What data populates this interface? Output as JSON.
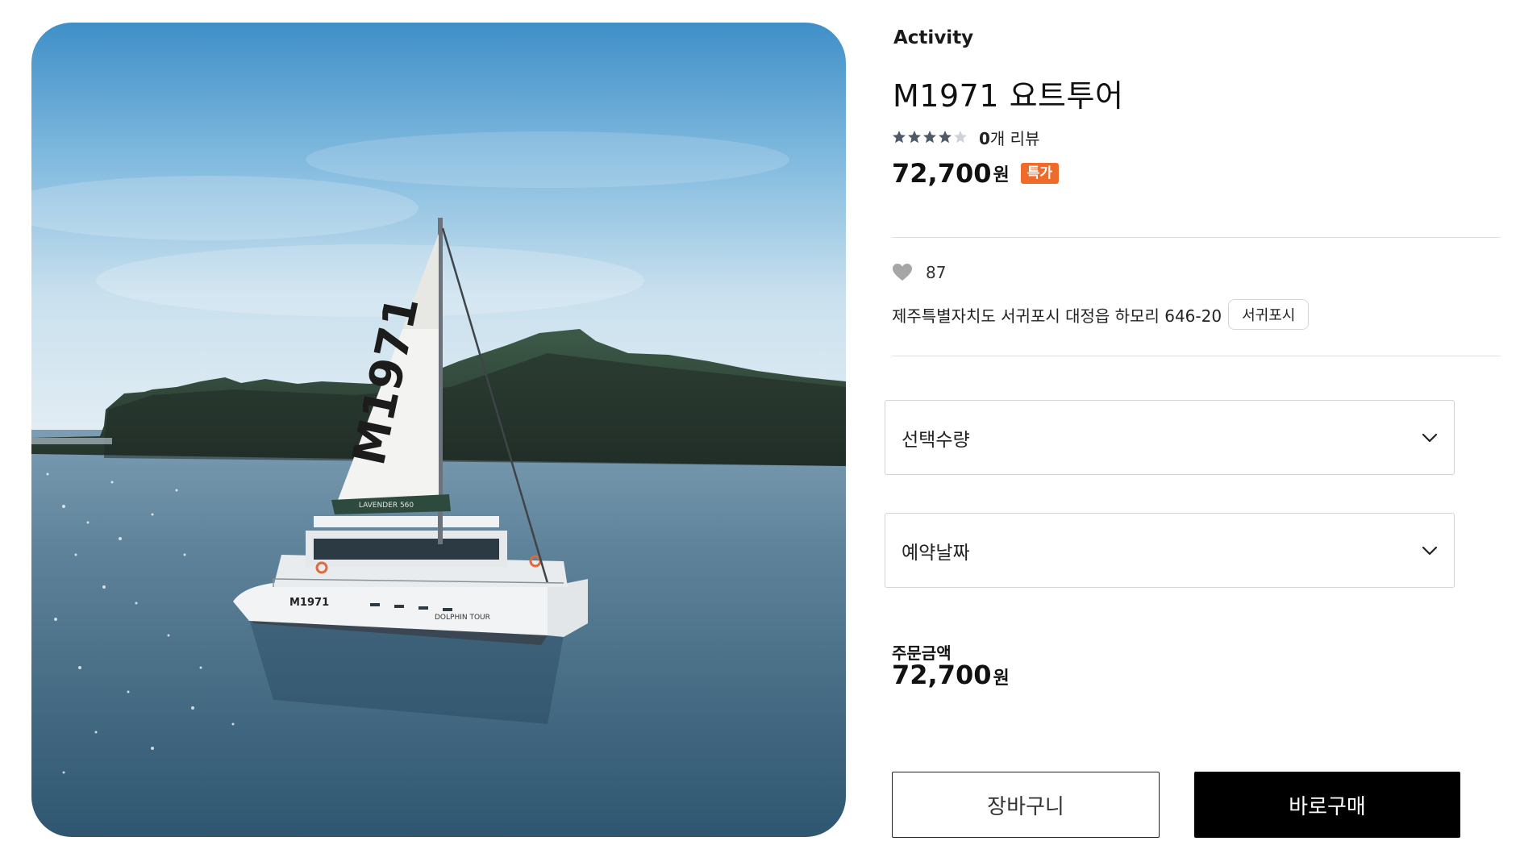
{
  "product": {
    "category": "Activity",
    "title": "M1971 요트투어",
    "rating": 4,
    "rating_max": 5,
    "review_count": "0",
    "review_suffix": "개 리뷰",
    "price": "72,700",
    "price_unit": "원",
    "badge": "특가",
    "likes": "87",
    "address": "제주특별자치도 서귀포시 대정읍 하모리 646-20",
    "region_tag": "서귀포시"
  },
  "image": {
    "sail_text": "M1971",
    "hull_brand": "M1971",
    "hull_text": "DOLPHIN TOUR",
    "boom_text": "LAVENDER 560"
  },
  "options": {
    "quantity_label": "선택수량",
    "date_label": "예약날짜"
  },
  "order": {
    "total_label": "주문금액",
    "total_price": "72,700",
    "total_unit": "원"
  },
  "actions": {
    "cart_label": "장바구니",
    "buy_label": "바로구매"
  },
  "colors": {
    "badge": "#f06a2a",
    "star_filled": "#4f5a66",
    "star_empty": "#cfd3d8",
    "heart": "#a6a6a6",
    "buy_button_bg": "#000000"
  },
  "icons": {
    "heart": "heart-icon",
    "star": "star-icon",
    "chevron": "chevron-down-icon"
  }
}
